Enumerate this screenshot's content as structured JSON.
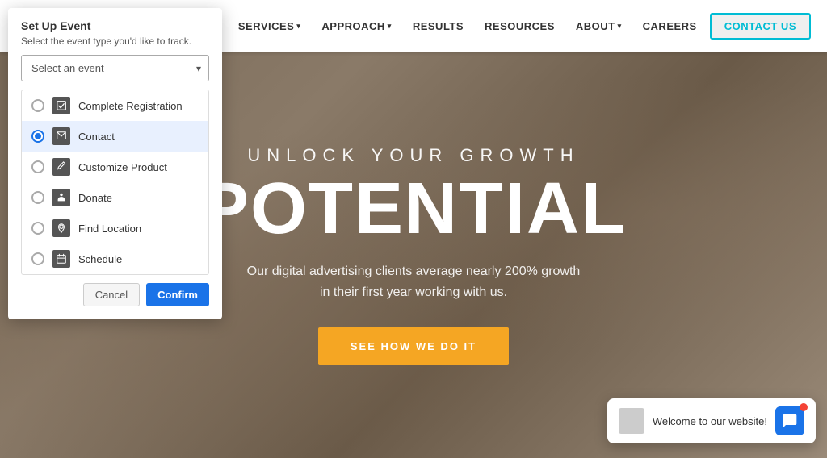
{
  "nav": {
    "links": [
      {
        "label": "SERVICES",
        "hasDropdown": true
      },
      {
        "label": "APPROACH",
        "hasDropdown": true
      },
      {
        "label": "RESULTS",
        "hasDropdown": false
      },
      {
        "label": "RESOURCES",
        "hasDropdown": false
      },
      {
        "label": "ABOUT",
        "hasDropdown": true
      },
      {
        "label": "CAREERS",
        "hasDropdown": false
      }
    ],
    "contact_label": "CONTACT US"
  },
  "hero": {
    "subtitle": "UNLOCK YOUR GROWTH",
    "title": "POTENTIAL",
    "description": "Our digital advertising clients average nearly 200% growth in their first year working with us.",
    "cta_label": "SEE HOW WE DO IT"
  },
  "setup_panel": {
    "title": "Set Up Event",
    "subtitle": "Select the event type you'd like to track.",
    "select_placeholder": "Select an event",
    "items": [
      {
        "id": "complete-registration",
        "label": "Complete Registration",
        "active": false
      },
      {
        "id": "contact",
        "label": "Contact",
        "active": true
      },
      {
        "id": "customize-product",
        "label": "Customize Product",
        "active": false
      },
      {
        "id": "donate",
        "label": "Donate",
        "active": false
      },
      {
        "id": "find-location",
        "label": "Find Location",
        "active": false
      },
      {
        "id": "schedule",
        "label": "Schedule",
        "active": false
      }
    ],
    "cancel_label": "Cancel",
    "confirm_label": "Confirm"
  },
  "chat": {
    "message": "Welcome to our website!"
  }
}
